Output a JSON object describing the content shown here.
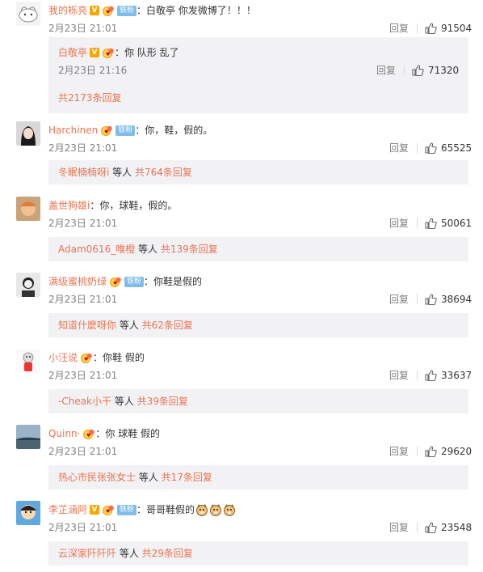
{
  "colors": {
    "username": "#eb7350",
    "link": "#eb7350",
    "meta": "#808080",
    "subbox": "#f2f2f5",
    "verified": "#f7a600",
    "fan_badge": "#7fbde8"
  },
  "comments": [
    {
      "username": "我的栎亮",
      "verified": true,
      "fan_badge": "铁粉",
      "text": "：白敬亭 你发微博了！！！",
      "time": "2月23日 21:01",
      "reply_label": "回复",
      "likes": "91504",
      "nested": {
        "username": "白敬亭",
        "verified": true,
        "text": "：你 队形 乱了",
        "time": "2月23日 21:16",
        "reply_label": "回复",
        "likes": "71320"
      },
      "more_link": "共2173条回复",
      "more_prefix": "",
      "more_mid": ""
    },
    {
      "username": "Harchinen",
      "verified": false,
      "fan_badge": "铁粉",
      "text": "：你，鞋，假的。",
      "time": "2月23日 21:01",
      "reply_label": "回复",
      "likes": "65525",
      "more_prefix": "冬眠楠楠呀i",
      "more_mid": " 等人 ",
      "more_link": "共764条回复"
    },
    {
      "username": "盖世狗雄i",
      "verified": false,
      "fan_badge": "",
      "text": "：你，球鞋，假的。",
      "time": "2月23日 21:01",
      "reply_label": "回复",
      "likes": "50061",
      "more_prefix": "Adam0616_唯橙",
      "more_mid": " 等人 ",
      "more_link": "共139条回复"
    },
    {
      "username": "满级蜜桃奶绿",
      "verified": false,
      "fan_badge": "铁粉",
      "text": "：你鞋是假的",
      "time": "2月23日 21:01",
      "reply_label": "回复",
      "likes": "38694",
      "more_prefix": "知道什麼呀你",
      "more_mid": " 等人 ",
      "more_link": "共62条回复"
    },
    {
      "username": "小汪说",
      "verified": false,
      "fan_badge": "",
      "text": "：你鞋 假的",
      "time": "2月23日 21:01",
      "reply_label": "回复",
      "likes": "33637",
      "more_prefix": "-Cheak小干",
      "more_mid": " 等人 ",
      "more_link": "共39条回复"
    },
    {
      "username": "Quinn·",
      "verified": false,
      "fan_badge": "",
      "text": "：你 球鞋 假的",
      "time": "2月23日 21:01",
      "reply_label": "回复",
      "likes": "29620",
      "more_prefix": "热心市民张张女士",
      "more_mid": " 等人 ",
      "more_link": "共17条回复"
    },
    {
      "username": "李芷涵阿",
      "verified": true,
      "fan_badge": "铁粉",
      "text": "：哥哥鞋假的",
      "time": "2月23日 21:01",
      "reply_label": "回复",
      "likes": "23548",
      "more_prefix": "云深家阡阡阡",
      "more_mid": " 等人 ",
      "more_link": "共29条回复"
    }
  ]
}
